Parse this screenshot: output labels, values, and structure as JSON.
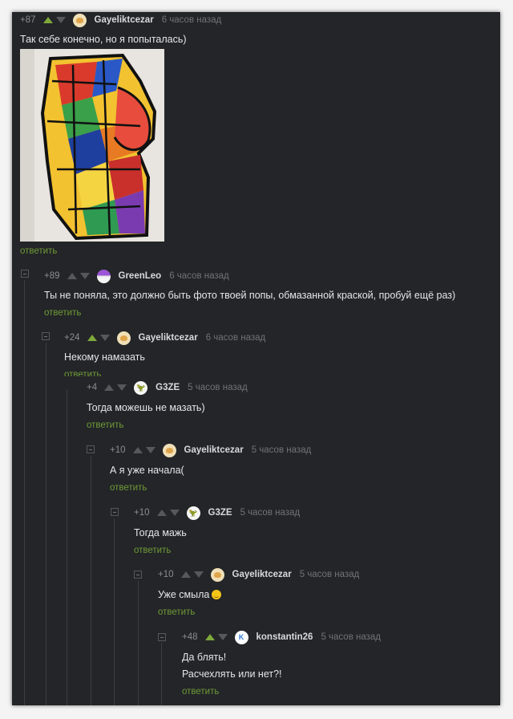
{
  "comments": [
    {
      "score": "+87",
      "author": "Gayeliktcezar",
      "time": "6 часов назад",
      "lines": [
        "Так себе конечно, но я попыталась)"
      ],
      "reply": "ответить",
      "upvoted": true,
      "avatar": "cat-avatar"
    },
    {
      "score": "+89",
      "author": "GreenLeo",
      "time": "6 часов назад",
      "lines": [
        "Ты не поняла, это должно быть фото твоей попы, обмазанной краской, пробуй ещё раз)"
      ],
      "reply": "ответить",
      "upvoted": false,
      "avatar": "pokeball-avatar"
    },
    {
      "score": "+24",
      "author": "Gayeliktcezar",
      "time": "6 часов назад",
      "lines": [
        "Некому намазать"
      ],
      "reply": "ответить",
      "upvoted": true,
      "avatar": "cat-avatar"
    },
    {
      "score": "+4",
      "author": "G3ZE",
      "time": "5 часов назад",
      "lines": [
        "Тогда можешь не мазать)"
      ],
      "reply": "ответить",
      "upvoted": false,
      "avatar": "dino-avatar",
      "avatar_letter": "🦖"
    },
    {
      "score": "+10",
      "author": "Gayeliktcezar",
      "time": "5 часов назад",
      "lines": [
        "А я уже начала("
      ],
      "reply": "ответить",
      "upvoted": false,
      "avatar": "cat-avatar"
    },
    {
      "score": "+10",
      "author": "G3ZE",
      "time": "5 часов назад",
      "lines": [
        "Тогда мажь"
      ],
      "reply": "ответить",
      "upvoted": false,
      "avatar": "dino-avatar",
      "avatar_letter": "🦖"
    },
    {
      "score": "+10",
      "author": "Gayeliktcezar",
      "time": "5 часов назад",
      "lines": [
        "Уже смыла"
      ],
      "reply": "ответить",
      "upvoted": false,
      "avatar": "cat-avatar"
    },
    {
      "score": "+48",
      "author": "konstantin26",
      "time": "5 часов назад",
      "lines": [
        "Да блять!",
        "Расчехлять или нет?!"
      ],
      "reply": "ответить",
      "upvoted": true,
      "avatar": "k-avatar",
      "avatar_letter": "K"
    }
  ],
  "colors": {
    "background": "#232528",
    "accent": "#6f9a36",
    "text": "#e5e6e8",
    "muted": "#707377"
  }
}
